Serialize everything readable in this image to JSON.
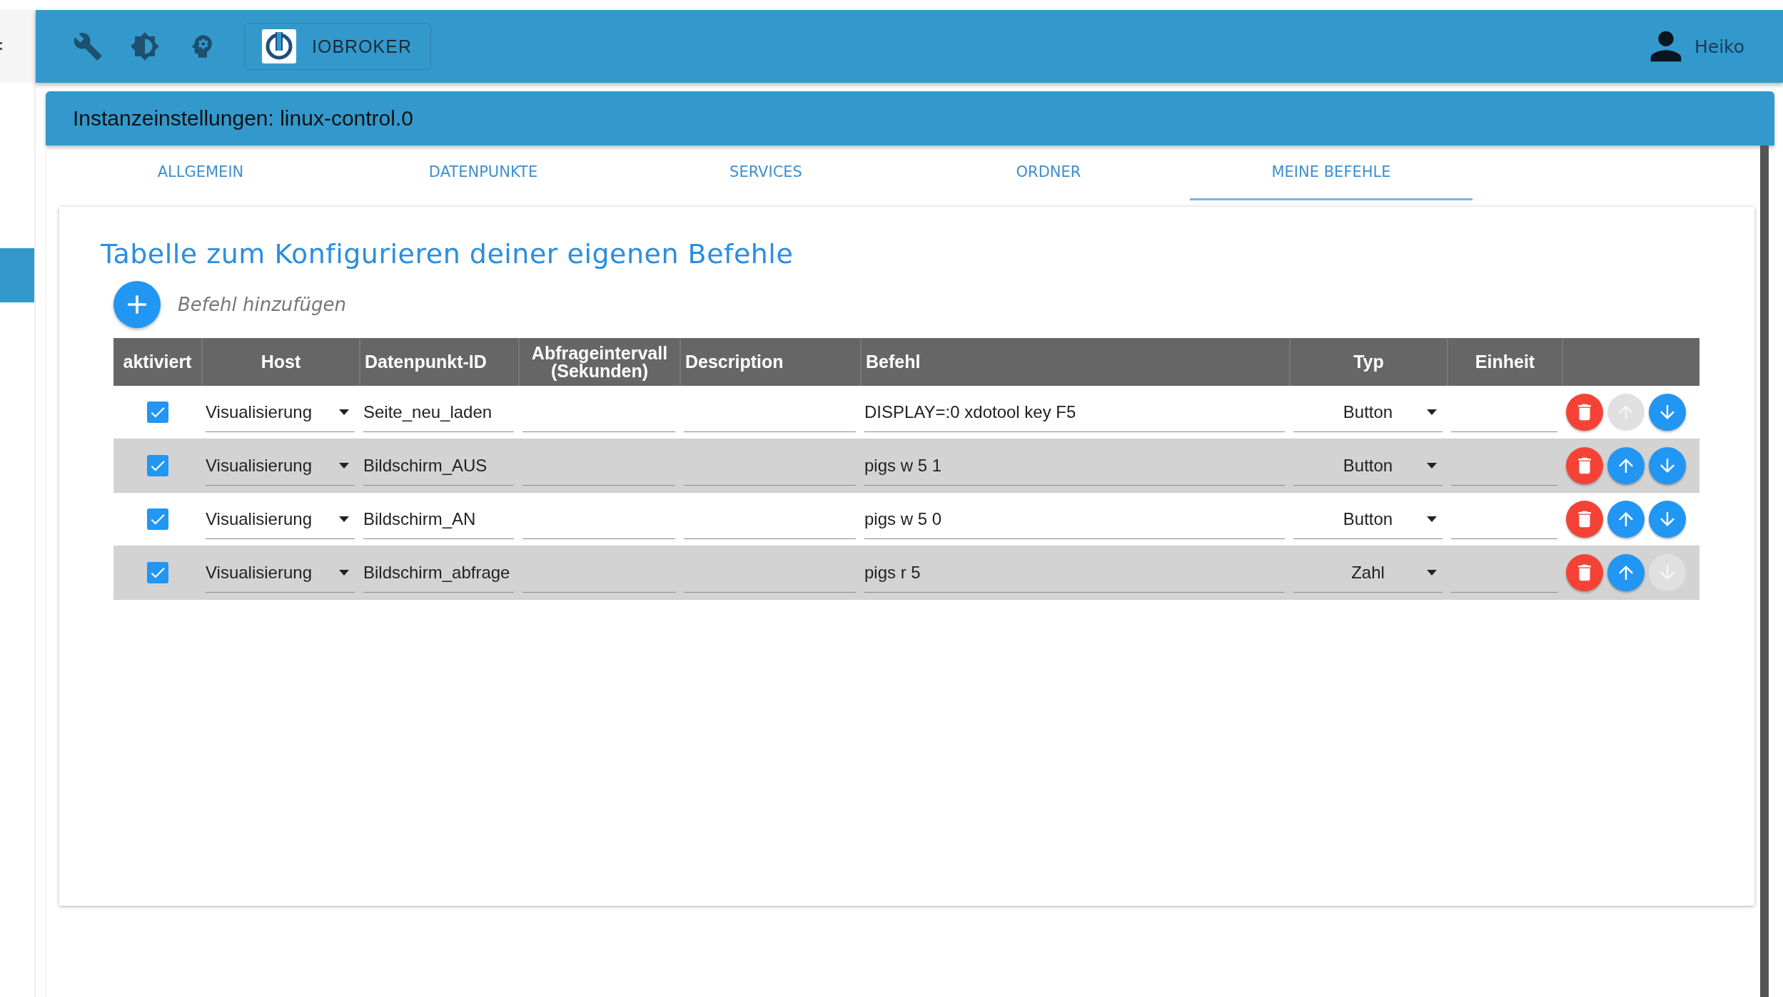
{
  "app_bar": {
    "brand": "IOBROKER",
    "user": "Heiko"
  },
  "title": "Instanzeinstellungen: linux-control.0",
  "tabs": [
    {
      "label": "ALLGEMEIN",
      "selected": false
    },
    {
      "label": "DATENPUNKTE",
      "selected": false
    },
    {
      "label": "SERVICES",
      "selected": false
    },
    {
      "label": "ORDNER",
      "selected": false
    },
    {
      "label": "MEINE BEFEHLE",
      "selected": true
    }
  ],
  "heading": "Tabelle zum Konfigurieren deiner eigenen Befehle",
  "add_button": {
    "label": "Befehl hinzufügen"
  },
  "table": {
    "columns": [
      "aktiviert",
      "Host",
      "Datenpunkt-ID",
      "Abfrageintervall (Sekunden)",
      "Description",
      "Befehl",
      "Typ",
      "Einheit"
    ],
    "rows": [
      {
        "checked": true,
        "host": "Visualisierung",
        "datapoint_id": "Seite_neu_laden",
        "command": "DISPLAY=:0 xdotool key F5",
        "type": "Button",
        "up_disabled": true,
        "down_disabled": false
      },
      {
        "checked": true,
        "host": "Visualisierung",
        "datapoint_id": "Bildschirm_AUS",
        "command": "pigs w 5 1",
        "type": "Button",
        "up_disabled": false,
        "down_disabled": false
      },
      {
        "checked": true,
        "host": "Visualisierung",
        "datapoint_id": "Bildschirm_AN",
        "command": "pigs w 5 0",
        "type": "Button",
        "up_disabled": false,
        "down_disabled": false
      },
      {
        "checked": true,
        "host": "Visualisierung",
        "datapoint_id": "Bildschirm_abfrage",
        "command": "pigs r 5",
        "type": "Zahl",
        "up_disabled": false,
        "down_disabled": true
      }
    ]
  }
}
